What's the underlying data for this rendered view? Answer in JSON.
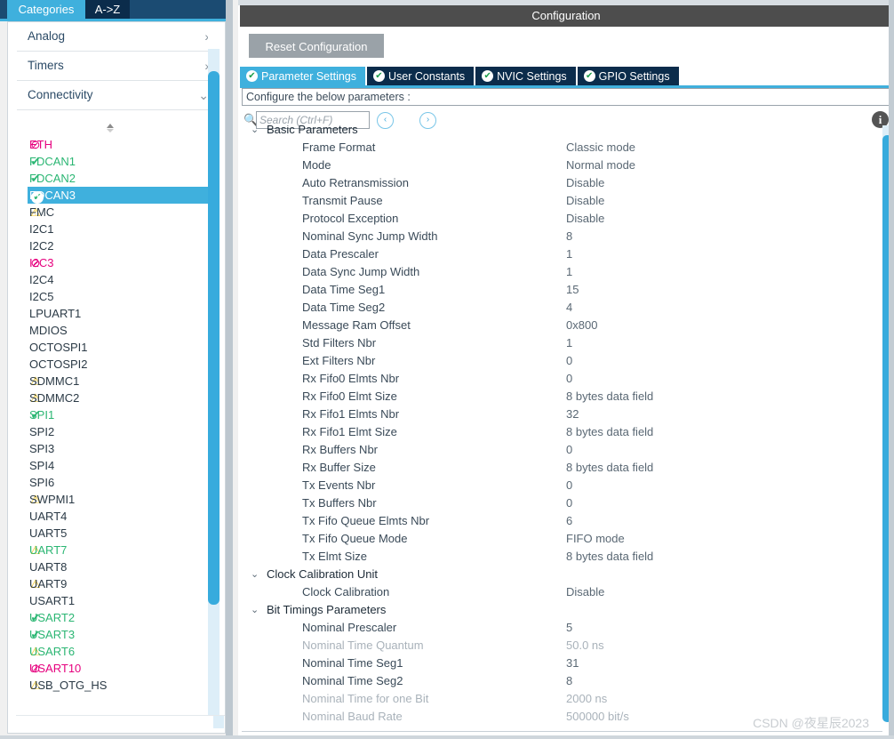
{
  "sidebar": {
    "tabs": [
      {
        "label": "Categories",
        "active": true
      },
      {
        "label": "A->Z",
        "active": false
      }
    ],
    "categories": [
      {
        "label": "Analog",
        "chevron": "›",
        "icon": "chevron-right-icon"
      },
      {
        "label": "Timers",
        "chevron": "›",
        "icon": "chevron-right-icon"
      },
      {
        "label": "Connectivity",
        "chevron": "⌄",
        "icon": "chevron-down-icon"
      }
    ],
    "splitter": "⬍",
    "peripherals": [
      {
        "label": "ETH",
        "status": "ban",
        "selected": false
      },
      {
        "label": "FDCAN1",
        "status": "check",
        "selected": false
      },
      {
        "label": "FDCAN2",
        "status": "check",
        "selected": false
      },
      {
        "label": "FDCAN3",
        "status": "check-circle",
        "selected": true
      },
      {
        "label": "FMC",
        "status": "warn",
        "selected": false
      },
      {
        "label": "I2C1",
        "status": "none",
        "selected": false
      },
      {
        "label": "I2C2",
        "status": "none",
        "selected": false
      },
      {
        "label": "I2C3",
        "status": "ban",
        "selected": false
      },
      {
        "label": "I2C4",
        "status": "none",
        "selected": false
      },
      {
        "label": "I2C5",
        "status": "none",
        "selected": false
      },
      {
        "label": "LPUART1",
        "status": "none",
        "selected": false
      },
      {
        "label": "MDIOS",
        "status": "none",
        "selected": false
      },
      {
        "label": "OCTOSPI1",
        "status": "none",
        "selected": false
      },
      {
        "label": "OCTOSPI2",
        "status": "none",
        "selected": false
      },
      {
        "label": "SDMMC1",
        "status": "warn",
        "selected": false
      },
      {
        "label": "SDMMC2",
        "status": "warn",
        "selected": false
      },
      {
        "label": "SPI1",
        "status": "check",
        "selected": false
      },
      {
        "label": "SPI2",
        "status": "none",
        "selected": false
      },
      {
        "label": "SPI3",
        "status": "none",
        "selected": false
      },
      {
        "label": "SPI4",
        "status": "none",
        "selected": false
      },
      {
        "label": "SPI6",
        "status": "none",
        "selected": false
      },
      {
        "label": "SWPMI1",
        "status": "warn",
        "selected": false
      },
      {
        "label": "UART4",
        "status": "none",
        "selected": false
      },
      {
        "label": "UART5",
        "status": "none",
        "selected": false
      },
      {
        "label": "UART7",
        "status": "warn-green",
        "selected": false
      },
      {
        "label": "UART8",
        "status": "none",
        "selected": false
      },
      {
        "label": "UART9",
        "status": "warn",
        "selected": false
      },
      {
        "label": "USART1",
        "status": "none",
        "selected": false
      },
      {
        "label": "USART2",
        "status": "check",
        "selected": false
      },
      {
        "label": "USART3",
        "status": "check",
        "selected": false
      },
      {
        "label": "USART6",
        "status": "warn-green",
        "selected": false
      },
      {
        "label": "USART10",
        "status": "ban",
        "selected": false
      },
      {
        "label": "USB_OTG_HS",
        "status": "warn",
        "selected": false
      }
    ]
  },
  "config": {
    "title": "Configuration",
    "reset_label": "Reset Configuration",
    "tabs": [
      {
        "label": "Parameter Settings",
        "active": true,
        "tick": "✔"
      },
      {
        "label": "User Constants",
        "active": false,
        "tick": "✔"
      },
      {
        "label": "NVIC Settings",
        "active": false,
        "tick": "✔"
      },
      {
        "label": "GPIO Settings",
        "active": false,
        "tick": "✔"
      }
    ],
    "configure_line": "Configure the below parameters :",
    "search": {
      "placeholder": "Search (Ctrl+F)",
      "value": "",
      "icon": "search-icon",
      "prev_label": "‹",
      "next_label": "›",
      "info_label": "i"
    },
    "groups": [
      {
        "name": "Basic Parameters",
        "chevron": "⌄",
        "rows": [
          {
            "name": "Frame Format",
            "value": "Classic mode",
            "dim": false
          },
          {
            "name": "Mode",
            "value": "Normal mode",
            "dim": false
          },
          {
            "name": "Auto Retransmission",
            "value": "Disable",
            "dim": false
          },
          {
            "name": "Transmit Pause",
            "value": "Disable",
            "dim": false
          },
          {
            "name": "Protocol Exception",
            "value": "Disable",
            "dim": false
          },
          {
            "name": "Nominal Sync Jump Width",
            "value": "8",
            "dim": false
          },
          {
            "name": "Data Prescaler",
            "value": "1",
            "dim": false
          },
          {
            "name": "Data Sync Jump Width",
            "value": "1",
            "dim": false
          },
          {
            "name": "Data Time Seg1",
            "value": "15",
            "dim": false
          },
          {
            "name": "Data Time Seg2",
            "value": "4",
            "dim": false
          },
          {
            "name": "Message Ram Offset",
            "value": "0x800",
            "dim": false
          },
          {
            "name": "Std Filters Nbr",
            "value": "1",
            "dim": false
          },
          {
            "name": "Ext Filters Nbr",
            "value": "0",
            "dim": false
          },
          {
            "name": "Rx Fifo0 Elmts Nbr",
            "value": "0",
            "dim": false
          },
          {
            "name": "Rx Fifo0 Elmt Size",
            "value": "8 bytes data field",
            "dim": false
          },
          {
            "name": "Rx Fifo1 Elmts Nbr",
            "value": "32",
            "dim": false
          },
          {
            "name": "Rx Fifo1 Elmt Size",
            "value": "8 bytes data field",
            "dim": false
          },
          {
            "name": "Rx Buffers Nbr",
            "value": "0",
            "dim": false
          },
          {
            "name": "Rx Buffer Size",
            "value": "8 bytes data field",
            "dim": false
          },
          {
            "name": "Tx Events Nbr",
            "value": "0",
            "dim": false
          },
          {
            "name": "Tx Buffers Nbr",
            "value": "0",
            "dim": false
          },
          {
            "name": "Tx Fifo Queue Elmts Nbr",
            "value": "6",
            "dim": false
          },
          {
            "name": "Tx Fifo Queue Mode",
            "value": "FIFO mode",
            "dim": false
          },
          {
            "name": "Tx Elmt Size",
            "value": "8 bytes data field",
            "dim": false
          }
        ]
      },
      {
        "name": "Clock Calibration Unit",
        "chevron": "⌄",
        "rows": [
          {
            "name": "Clock Calibration",
            "value": "Disable",
            "dim": false
          }
        ]
      },
      {
        "name": "Bit Timings Parameters",
        "chevron": "⌄",
        "rows": [
          {
            "name": "Nominal Prescaler",
            "value": "5",
            "dim": false
          },
          {
            "name": "Nominal Time Quantum",
            "value": "50.0 ns",
            "dim": true
          },
          {
            "name": "Nominal Time Seg1",
            "value": "31",
            "dim": false
          },
          {
            "name": "Nominal Time Seg2",
            "value": "8",
            "dim": false
          },
          {
            "name": "Nominal Time for one Bit",
            "value": "2000 ns",
            "dim": true
          },
          {
            "name": "Nominal Baud Rate",
            "value": "500000 bit/s",
            "dim": true
          }
        ]
      }
    ]
  },
  "watermark": "CSDN @夜星辰2023",
  "colors": {
    "accent_blue": "#3fb0dd",
    "dark_navy": "#0b2c4b",
    "title_gray": "#4d4d4d",
    "green": "#2bb673",
    "pink": "#e6007e",
    "amber": "#f5c518"
  }
}
